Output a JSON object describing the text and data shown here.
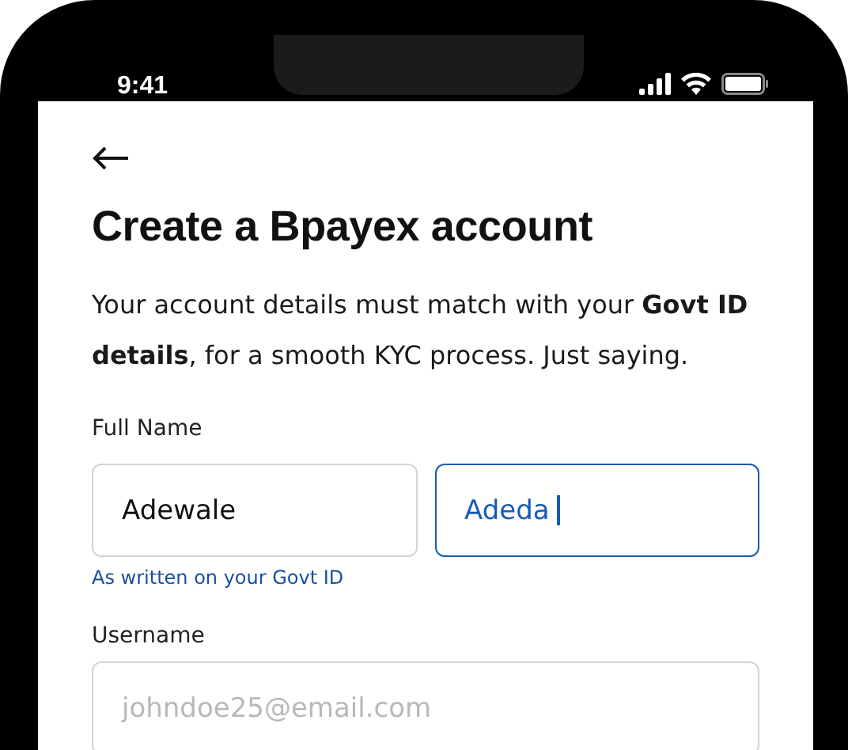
{
  "status_bar": {
    "time": "9:41"
  },
  "title": "Create a Bpayex account",
  "intro": "Your account details must match with your **Govt ID details**, for a smooth KYC process. Just saying.",
  "full_name": {
    "label": "Full Name",
    "fields": [
      {
        "value": "Adewale",
        "focused": false
      },
      {
        "value": "Adeda",
        "focused": true
      }
    ],
    "helper": "As written on your Govt ID"
  },
  "username": {
    "label": "Username",
    "placeholder": "johndoe25@email.com"
  }
}
